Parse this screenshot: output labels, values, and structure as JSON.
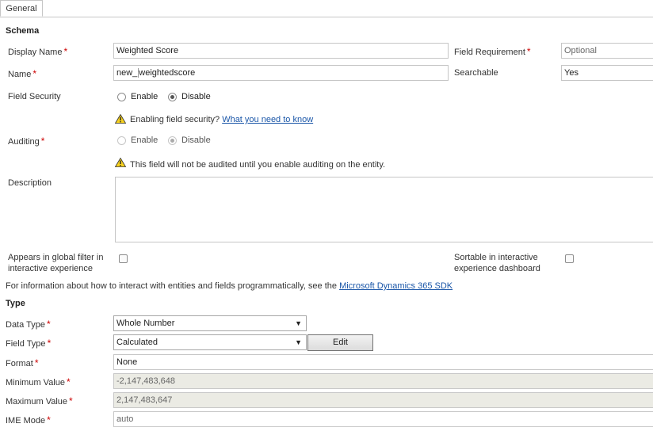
{
  "tabs": [
    {
      "label": "General"
    }
  ],
  "schema": {
    "title": "Schema",
    "display_name": {
      "label": "Display Name",
      "value": "Weighted Score"
    },
    "name": {
      "label": "Name",
      "prefix": "new_",
      "value": "weightedscore"
    },
    "field_requirement": {
      "label": "Field Requirement",
      "value": "Optional"
    },
    "searchable": {
      "label": "Searchable",
      "value": "Yes"
    },
    "field_security": {
      "label": "Field Security",
      "enable": "Enable",
      "disable": "Disable",
      "warning": "Enabling field security?",
      "link": "What you need to know"
    },
    "auditing": {
      "label": "Auditing",
      "enable": "Enable",
      "disable": "Disable",
      "warning": "This field will not be audited until you enable auditing on the entity."
    },
    "description": {
      "label": "Description"
    },
    "global_filter": {
      "label_line1": "Appears in global filter in",
      "label_line2": "interactive experience"
    },
    "sortable": {
      "label_line1": "Sortable in interactive",
      "label_line2": "experience dashboard"
    },
    "sdk_info": "For information about how to interact with entities and fields programmatically, see the",
    "sdk_link": "Microsoft Dynamics 365 SDK"
  },
  "type": {
    "title": "Type",
    "data_type": {
      "label": "Data Type",
      "value": "Whole Number"
    },
    "field_type": {
      "label": "Field Type",
      "value": "Calculated",
      "edit": "Edit"
    },
    "format": {
      "label": "Format",
      "value": "None"
    },
    "minimum": {
      "label": "Minimum Value",
      "value": "-2,147,483,648"
    },
    "maximum": {
      "label": "Maximum Value",
      "value": "2,147,483,647"
    },
    "ime_mode": {
      "label": "IME Mode",
      "value": "auto"
    }
  },
  "required_marker": "*",
  "colors": {
    "required": "#cc0000",
    "link": "#1a56a8",
    "border": "#c6c6c6",
    "disabled_field": "#ebebe4"
  },
  "icons": {
    "warning": "warning-icon",
    "dropdown": "chevron-down-icon"
  }
}
